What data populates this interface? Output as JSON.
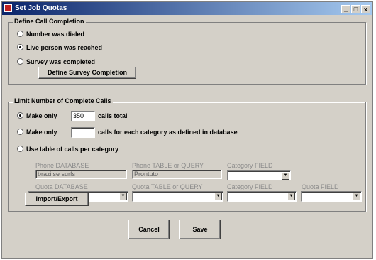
{
  "window": {
    "title": "Set Job Quotas",
    "controls": [
      "_",
      "□",
      "x"
    ]
  },
  "define_call_completion": {
    "legend": "Define Call Completion",
    "options": [
      {
        "label": "Number was dialed",
        "selected": false
      },
      {
        "label": "Live person was reached",
        "selected": true
      },
      {
        "label": "Survey was completed",
        "selected": false
      }
    ],
    "define_survey_button": "Define Survey Completion"
  },
  "limit_complete_calls": {
    "legend": "Limit Number of Complete Calls",
    "make_only_label": "Make only",
    "total_value": "350",
    "calls_total_label": "calls total",
    "make_only_label_2": "Make only",
    "per_category_value": "",
    "per_category_label": "calls for each category as defined in database",
    "use_table_label": "Use table of calls per category",
    "selected_option": "total"
  },
  "table_fields": {
    "phone_database_label": "Phone DATABASE",
    "phone_database_value": "brazilse surfs",
    "phone_table_label": "Phone TABLE or QUERY",
    "phone_table_value": "Prontuto",
    "category_field_label_1": "Category FIELD",
    "quota_database_label": "Quota DATABASE",
    "quota_table_label": "Quota TABLE or QUERY",
    "category_field_label_2": "Category FIELD",
    "quota_field_label": "Quota FIELD"
  },
  "buttons": {
    "import_export": "Import/Export",
    "cancel": "Cancel",
    "save": "Save"
  }
}
